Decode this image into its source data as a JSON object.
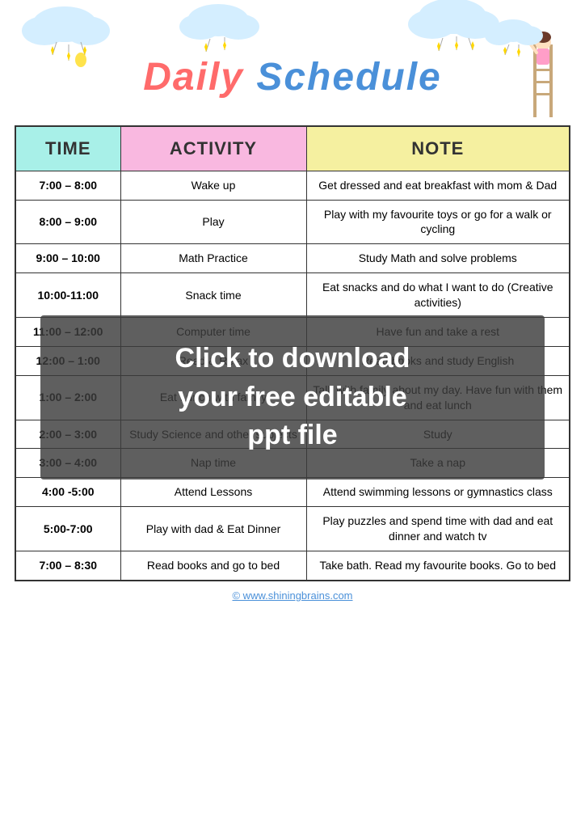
{
  "header": {
    "title_daily": "Daily",
    "title_schedule": "Schedule"
  },
  "table": {
    "headers": {
      "time": "TIME",
      "activity": "ACTIVITY",
      "note": "NOTE"
    },
    "rows": [
      {
        "time": "7:00 – 8:00",
        "activity": "Wake up",
        "note": "Get dressed and eat breakfast with mom & Dad"
      },
      {
        "time": "8:00 – 9:00",
        "activity": "Play",
        "note": "Play with my favourite toys or go for a walk or cycling"
      },
      {
        "time": "9:00 – 10:00",
        "activity": "Math Practice",
        "note": "Study Math and solve problems"
      },
      {
        "time": "10:00-11:00",
        "activity": "Snack time",
        "note": "Eat snacks and do what I want to do (Creative activities)"
      },
      {
        "time": "11:00 – 12:00",
        "activity": "Computer time",
        "note": "Have fun and take a rest"
      },
      {
        "time": "12:00 – 1:00",
        "activity": "Read & Relax",
        "note": "Read books and study English"
      },
      {
        "time": "1:00 – 2:00",
        "activity": "Eat Lunch with family",
        "note": "Talk with family about my day. Have fun with them and eat lunch"
      },
      {
        "time": "2:00 – 3:00",
        "activity": "Study Science and other subjects",
        "note": "Study"
      },
      {
        "time": "3:00 – 4:00",
        "activity": "Nap time",
        "note": "Take a nap"
      },
      {
        "time": "4:00 -5:00",
        "activity": "Attend Lessons",
        "note": "Attend swimming lessons or gymnastics class"
      },
      {
        "time": "5:00-7:00",
        "activity": "Play with dad & Eat Dinner",
        "note": "Play puzzles and spend time with dad and eat dinner and watch tv"
      },
      {
        "time": "7:00 – 8:30",
        "activity": "Read books and go to bed",
        "note": "Take bath. Read my favourite books. Go to bed"
      }
    ]
  },
  "overlay": {
    "line1": "Click to download",
    "line2": "your free editable",
    "line3": "ppt file"
  },
  "footer": {
    "url": "© www.shiningbrains.com"
  }
}
